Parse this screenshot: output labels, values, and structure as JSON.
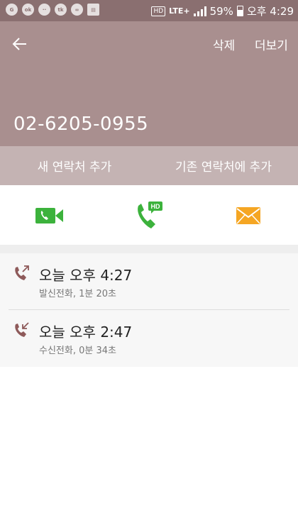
{
  "status_bar": {
    "icons": [
      "notification-icon",
      "kakao-icon",
      "chat-icon",
      "talk-icon",
      "wechat-icon",
      "clipboard-icon"
    ],
    "hd_badge": "HD",
    "network": "LTE+",
    "battery": "59%",
    "time": "오후 4:29"
  },
  "header": {
    "back_icon": "arrow-left-icon",
    "delete_label": "삭제",
    "more_label": "더보기",
    "phone_number": "02-6205-0955"
  },
  "add_bar": {
    "new_contact_label": "새 연락처 추가",
    "existing_contact_label": "기존 연락처에 추가"
  },
  "actions": {
    "video_call_icon": "video-call-icon",
    "hd_voice_call_icon": "hd-voice-call-icon",
    "hd_badge": "HD",
    "message_icon": "message-envelope-icon",
    "colors": {
      "video": "#3cb23c",
      "call": "#3cb23c",
      "message": "#f5a623"
    }
  },
  "call_log": [
    {
      "time": "오늘 오후 4:27",
      "detail": "발신전화, 1분 20초",
      "direction": "outgoing",
      "icon": "outgoing-call-icon"
    },
    {
      "time": "오늘 오후 2:47",
      "detail": "수신전화, 0분 34초",
      "direction": "incoming",
      "icon": "incoming-call-icon"
    }
  ],
  "colors": {
    "status_bar": "#8a6f70",
    "header": "#a98f8f",
    "add_bar": "#c4b3b3",
    "log_icon": "#8e5a5a"
  }
}
